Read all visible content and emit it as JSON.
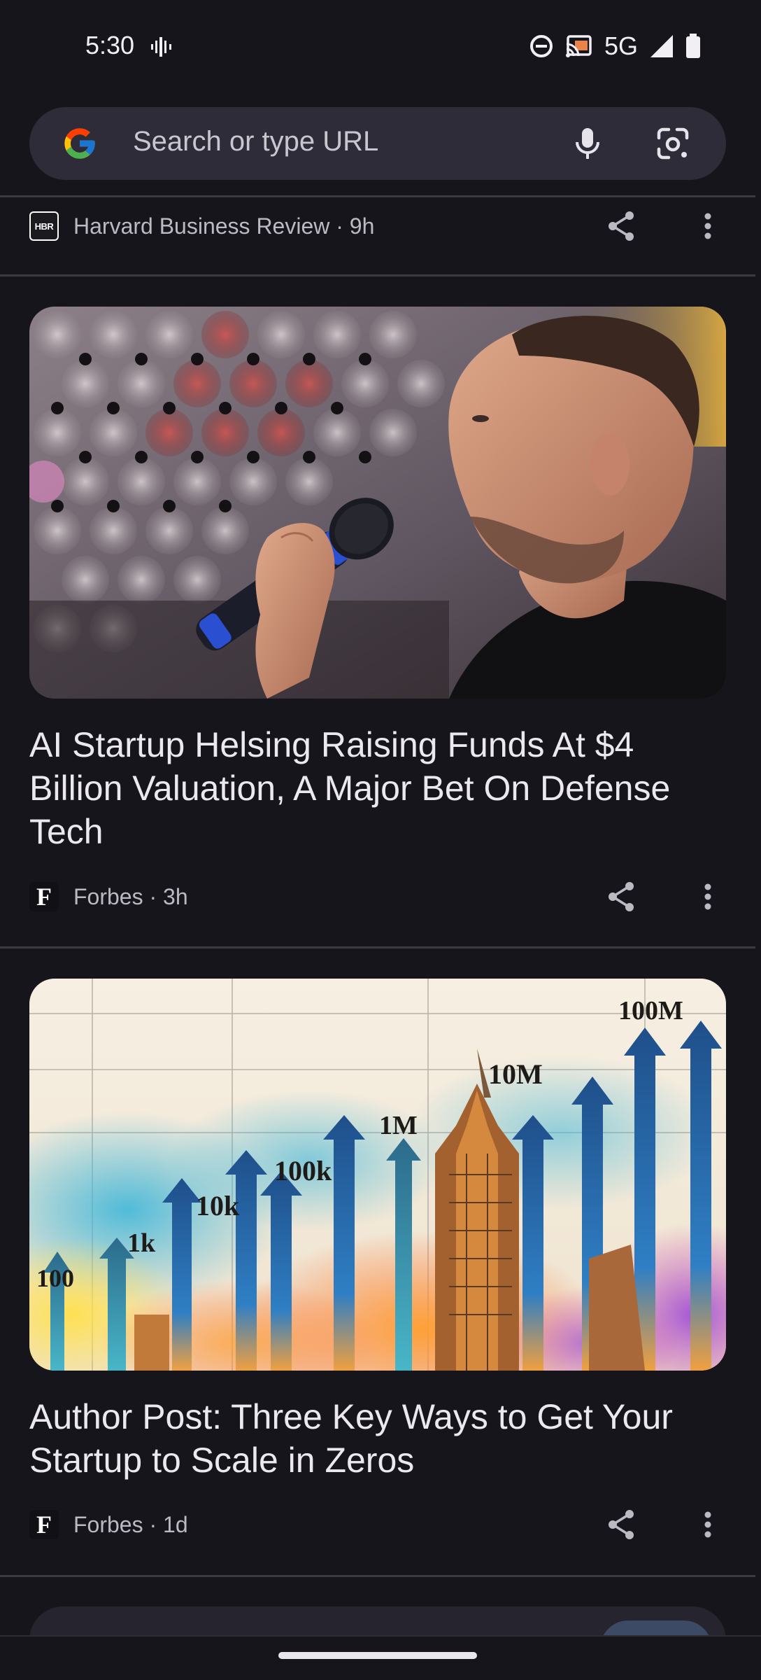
{
  "status_bar": {
    "time": "5:30",
    "network": "5G",
    "icons": [
      "vibrate-icon",
      "do-not-disturb-icon",
      "cast-icon",
      "signal-icon",
      "battery-icon"
    ]
  },
  "search": {
    "placeholder": "Search or type URL",
    "icons": [
      "google-logo",
      "mic-icon",
      "lens-icon"
    ]
  },
  "feed": {
    "items": [
      {
        "source": "Harvard Business Review · 9h",
        "logo_text": "HBR"
      },
      {
        "title": "AI Startup Helsing Raising Funds At $4 Billion Valuation, A Major Bet On Defense Tech",
        "source": "Forbes · 3h",
        "logo_text": "F",
        "image": "man-speaking-into-microphone"
      },
      {
        "title": "Author Post: Three Key Ways to Get Your Startup to Scale in Zeros",
        "source": "Forbes · 1d",
        "logo_text": "F",
        "image": "growth-arrows-illustration",
        "image_labels": [
          "100",
          "1k",
          "10k",
          "100k",
          "1M",
          "10M",
          "100M"
        ]
      }
    ]
  },
  "colors": {
    "background": "#16151b",
    "search_bar": "#2e2c38",
    "divider": "#3c3a44"
  }
}
